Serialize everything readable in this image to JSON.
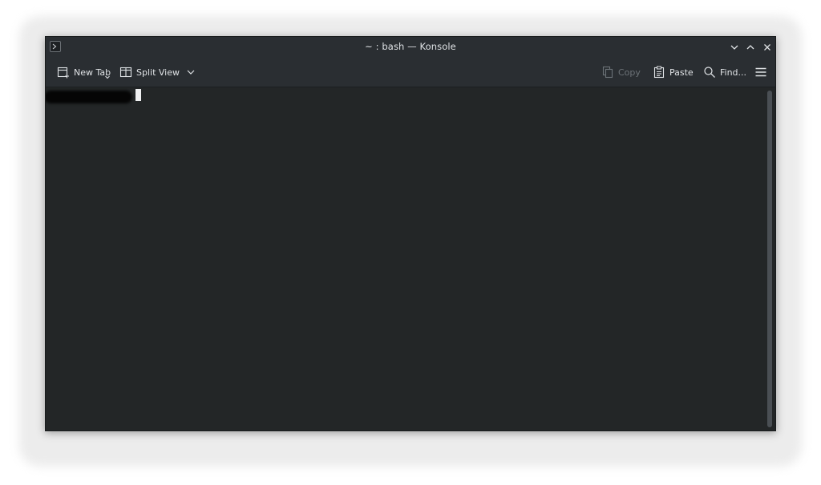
{
  "window": {
    "title": "~ : bash — Konsole",
    "controls": [
      "minimize",
      "maximize",
      "close"
    ]
  },
  "toolbar": {
    "new_tab_label": "New Tab",
    "split_view_label": "Split View",
    "copy_label": "Copy",
    "paste_label": "Paste",
    "find_label": "Find...",
    "copy_enabled": false
  },
  "terminal": {
    "prompt": "",
    "prompt_redacted": true
  },
  "icons": {
    "app": "konsole-icon",
    "new_tab": "new-tab-icon",
    "split_view": "split-view-icon",
    "copy": "copy-icon",
    "paste": "paste-icon",
    "find": "search-icon",
    "menu": "hamburger-menu-icon"
  },
  "colors": {
    "terminal_bg": "#232627",
    "chrome_bg": "#2a2e32",
    "text": "#e0e3e6",
    "disabled_text": "#6c7277"
  }
}
